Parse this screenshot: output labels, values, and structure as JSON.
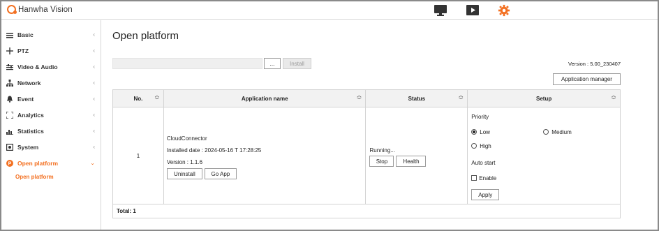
{
  "brand": {
    "name": "Hanwha Vision",
    "accent": "#f37021"
  },
  "topnav": {
    "icons": [
      "monitor-icon",
      "playback-icon",
      "settings-gear-icon"
    ]
  },
  "sidebar": {
    "items": [
      {
        "label": "Basic",
        "icon": "list-icon"
      },
      {
        "label": "PTZ",
        "icon": "ptz-icon"
      },
      {
        "label": "Video & Audio",
        "icon": "sliders-icon"
      },
      {
        "label": "Network",
        "icon": "network-icon"
      },
      {
        "label": "Event",
        "icon": "bell-icon"
      },
      {
        "label": "Analytics",
        "icon": "analytics-icon"
      },
      {
        "label": "Statistics",
        "icon": "bar-chart-icon"
      },
      {
        "label": "System",
        "icon": "system-icon"
      },
      {
        "label": "Open platform",
        "icon": "open-platform-icon",
        "active": true
      }
    ],
    "sub_item": "Open platform"
  },
  "page": {
    "title": "Open platform",
    "browse_label": "...",
    "install_label": "Install",
    "version_text": "Version : 5.00_230407",
    "app_manager_label": "Application manager"
  },
  "table": {
    "headers": [
      "No.",
      "Application name",
      "Status",
      "Setup"
    ],
    "row": {
      "no": "1",
      "app_name": "CloudConnector",
      "installed": "Installed date : 2024-05-16 T 17:28:25",
      "version": "Version : 1.1.6",
      "uninstall_label": "Uninstall",
      "goapp_label": "Go App",
      "status": "Running...",
      "stop_label": "Stop",
      "health_label": "Health",
      "priority_label": "Priority",
      "priority_options": [
        "Low",
        "Medium",
        "High"
      ],
      "priority_selected": "Low",
      "autostart_label": "Auto start",
      "enable_label": "Enable",
      "enable_checked": false,
      "apply_label": "Apply"
    },
    "total": "Total: 1"
  }
}
